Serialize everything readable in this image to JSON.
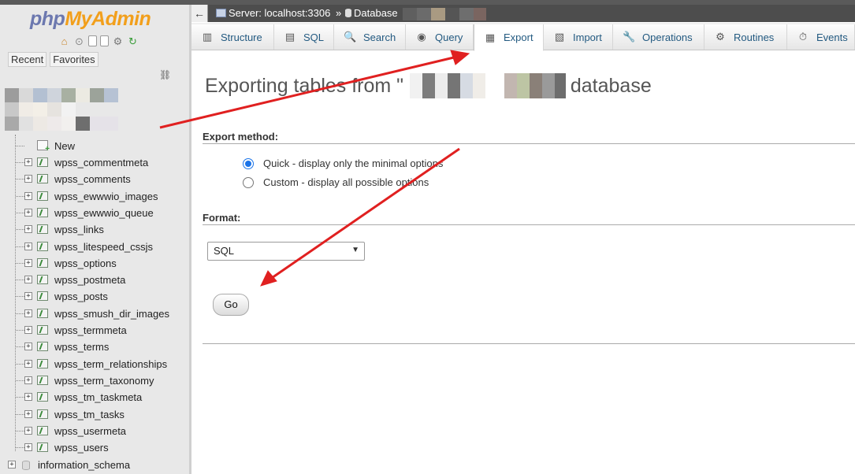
{
  "app": {
    "logo_php": "php",
    "logo_myadmin": "MyAdmin",
    "quick_icons": [
      "home-icon",
      "exit-icon",
      "docs-icon",
      "sql-docs-icon",
      "gear-icon",
      "reload-icon"
    ]
  },
  "sidebar": {
    "recent_label": "Recent",
    "favorites_label": "Favorites",
    "new_label": "New",
    "tables": [
      "wpss_commentmeta",
      "wpss_comments",
      "wpss_ewwwio_images",
      "wpss_ewwwio_queue",
      "wpss_links",
      "wpss_litespeed_cssjs",
      "wpss_options",
      "wpss_postmeta",
      "wpss_posts",
      "wpss_smush_dir_images",
      "wpss_termmeta",
      "wpss_terms",
      "wpss_term_relationships",
      "wpss_term_taxonomy",
      "wpss_tm_taskmeta",
      "wpss_tm_tasks",
      "wpss_usermeta",
      "wpss_users"
    ],
    "other_database": "information_schema"
  },
  "breadcrumb": {
    "back": "←",
    "server": "Server: localhost:3306",
    "separator": "»",
    "database": "Database"
  },
  "tabs": [
    {
      "label": "Structure",
      "icon": "structure-icon"
    },
    {
      "label": "SQL",
      "icon": "sql-icon"
    },
    {
      "label": "Search",
      "icon": "search-icon"
    },
    {
      "label": "Query",
      "icon": "query-icon"
    },
    {
      "label": "Export",
      "icon": "export-icon",
      "active": true
    },
    {
      "label": "Import",
      "icon": "import-icon"
    },
    {
      "label": "Operations",
      "icon": "wrench-icon"
    },
    {
      "label": "Routines",
      "icon": "routines-icon"
    },
    {
      "label": "Events",
      "icon": "clock-icon"
    }
  ],
  "main": {
    "title_prefix": "Exporting tables from \"",
    "title_suffix": "\" database",
    "export_method_label": "Export method:",
    "quick_option": "Quick - display only the minimal options",
    "custom_option": "Custom - display all possible options",
    "format_label": "Format:",
    "format_value": "SQL",
    "go_label": "Go"
  },
  "colors": {
    "annotation_arrow": "#e02020",
    "tab_text": "#235a81",
    "radio_selected": "#1a73e8"
  }
}
